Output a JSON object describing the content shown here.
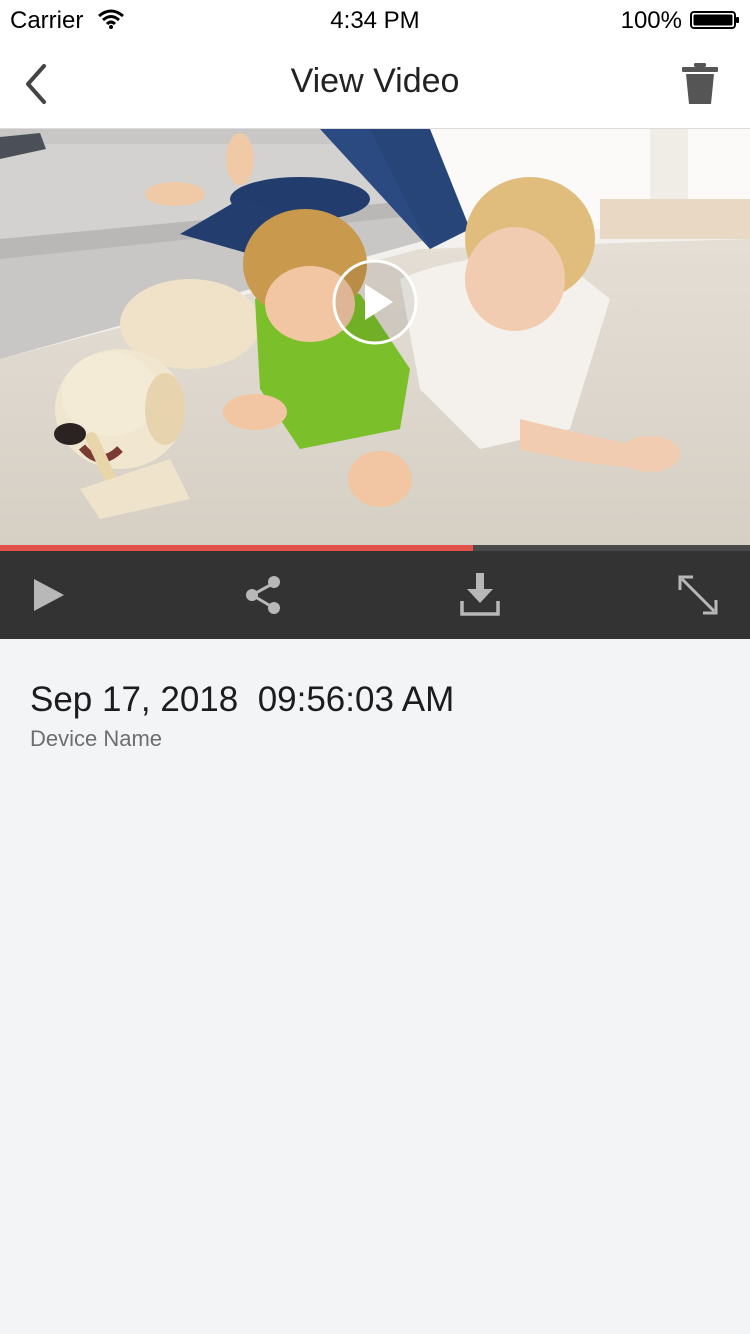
{
  "status_bar": {
    "carrier": "Carrier",
    "time": "4:34 PM",
    "battery": "100%"
  },
  "nav": {
    "title": "View Video",
    "back_icon": "chevron-left-icon",
    "delete_icon": "trash-icon"
  },
  "video": {
    "progress": 0.63,
    "accent_color": "#e0524a"
  },
  "controls": {
    "play_icon": "play-icon",
    "share_icon": "share-icon",
    "download_icon": "download-icon",
    "fullscreen_icon": "expand-icon"
  },
  "recording": {
    "datetime": "Sep 17, 2018  09:56:03 AM",
    "device_name": "Device Name"
  }
}
